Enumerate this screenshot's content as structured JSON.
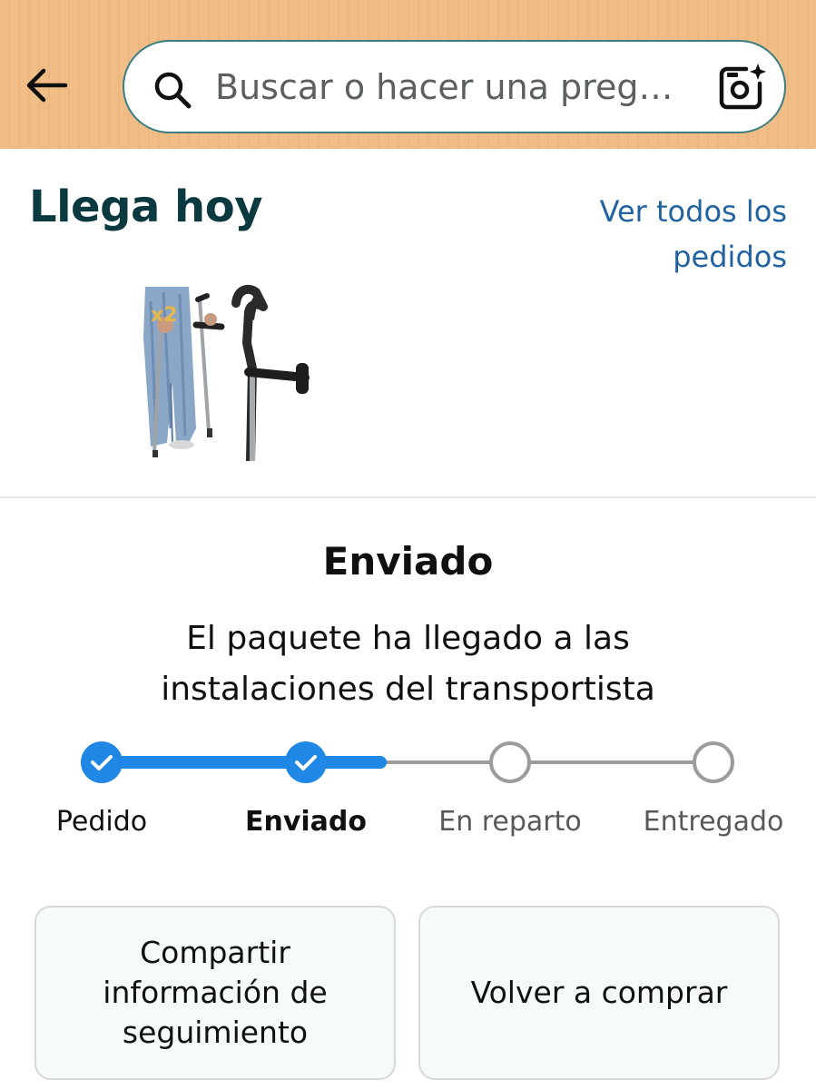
{
  "header": {
    "search": {
      "placeholder": "Buscar o hacer una preg…"
    }
  },
  "delivery": {
    "title": "Llega hoy",
    "orders_link": "Ver todos los pedidos",
    "product_badge": "x2"
  },
  "status": {
    "title": "Enviado",
    "description": "El paquete ha llegado a las instalaciones del transportista",
    "progress_fraction": 0.5,
    "steps": [
      {
        "label": "Pedido",
        "state": "done"
      },
      {
        "label": "Enviado",
        "state": "current"
      },
      {
        "label": "En reparto",
        "state": "pending"
      },
      {
        "label": "Entregado",
        "state": "pending"
      }
    ]
  },
  "actions": {
    "share_label": "Compartir información de seguimiento",
    "buy_again_label": "Volver a comprar"
  },
  "colors": {
    "header_bg": "#f0bd86",
    "title": "#0a3940",
    "link": "#2162a1",
    "progress_active": "#1f87e5",
    "progress_inactive": "#9c9c9c"
  },
  "icons": [
    "arrow-left-icon",
    "search-icon",
    "camera-sparkle-icon",
    "checkmark-icon"
  ]
}
